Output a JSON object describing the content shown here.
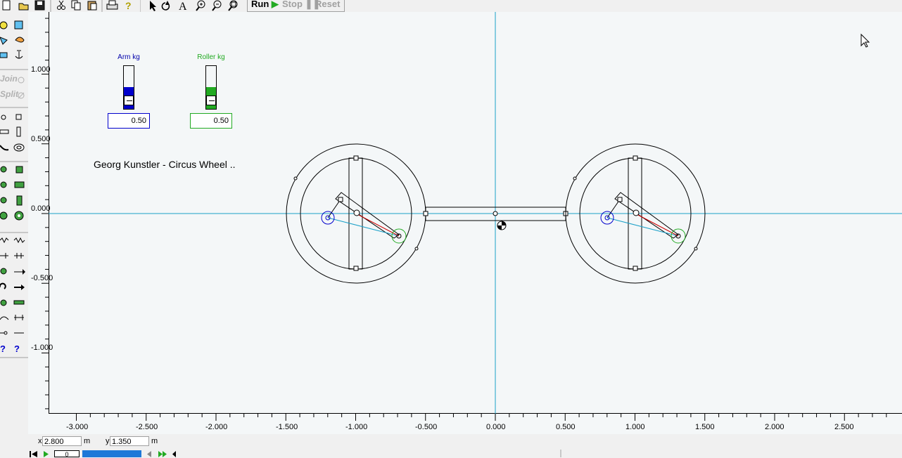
{
  "toolbar": {
    "run_label": "Run",
    "stop_label": "Stop",
    "reset_label": "Reset",
    "icons": [
      "new-icon",
      "open-icon",
      "save-icon",
      "cut-icon",
      "copy-icon",
      "paste-icon",
      "print-icon",
      "help-icon",
      "arrow-select-icon",
      "rotate-icon",
      "text-icon",
      "zoom-in-icon",
      "zoom-out-icon",
      "zoom-fit-icon"
    ]
  },
  "palette": {
    "join_label": "Join",
    "split_label": "Split"
  },
  "rulers": {
    "vertical": [
      "1.000",
      "0.500",
      "0.000",
      "-0.500",
      "-1.000"
    ],
    "horizontal": [
      "-3.000",
      "-2.500",
      "-2.000",
      "-1.500",
      "-1.000",
      "-0.500",
      "0.000",
      "0.500",
      "1.000",
      "1.500",
      "2.000",
      "2.500"
    ]
  },
  "sliders": [
    {
      "title": "Arm kg",
      "value": "0.50",
      "color": "#0000cc",
      "fill": 0.5
    },
    {
      "title": "Roller kg",
      "value": "0.50",
      "color": "#22aa22",
      "fill": 0.5
    }
  ],
  "scene": {
    "title": "Georg Kunstler - Circus Wheel .."
  },
  "status": {
    "x_label": "x",
    "x_value": "2.800",
    "x_unit": "m",
    "y_label": "y",
    "y_value": "1.350",
    "y_unit": "m"
  },
  "playbar": {
    "frame": "0"
  },
  "colors": {
    "axis": "#1aa0c8",
    "canvas": "#f4f7f8",
    "arm": "#0000cc",
    "roller": "#22aa22",
    "link_red": "#cc0000"
  }
}
